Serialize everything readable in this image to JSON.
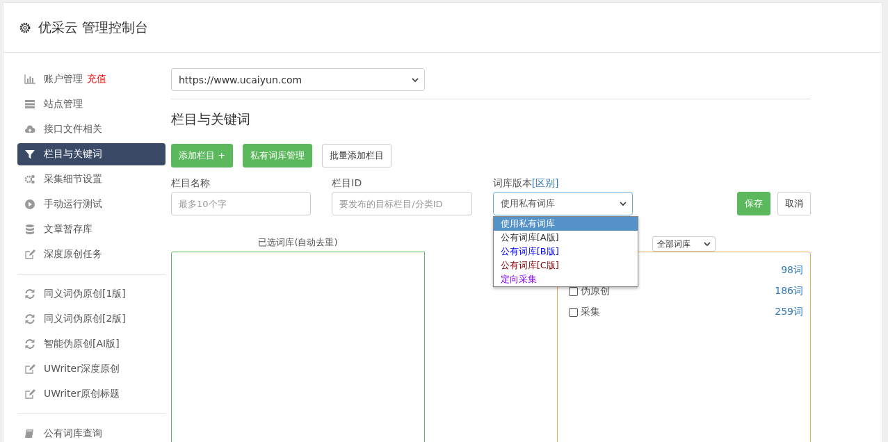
{
  "header": {
    "title": "优采云 管理控制台"
  },
  "sidebar": {
    "groups": [
      [
        {
          "label": "账户管理",
          "badge": "充值",
          "selected": false
        },
        {
          "label": "站点管理",
          "selected": false
        },
        {
          "label": "接口文件相关",
          "selected": false
        },
        {
          "label": "栏目与关键词",
          "selected": true
        },
        {
          "label": "采集细节设置",
          "selected": false
        },
        {
          "label": "手动运行测试",
          "selected": false
        },
        {
          "label": "文章暂存库",
          "selected": false
        },
        {
          "label": "深度原创任务",
          "selected": false
        }
      ],
      [
        {
          "label": "同义词伪原创[1版]",
          "selected": false
        },
        {
          "label": "同义词伪原创[2版]",
          "selected": false
        },
        {
          "label": "智能伪原创[AI版]",
          "selected": false
        },
        {
          "label": "UWriter深度原创",
          "selected": false
        },
        {
          "label": "UWriter原创标题",
          "selected": false
        }
      ],
      [
        {
          "label": "公有词库查询",
          "selected": false
        }
      ]
    ]
  },
  "site_select": {
    "value": "https://www.ucaiyun.com"
  },
  "section_title": "栏目与关键词",
  "actions": [
    {
      "label": "添加栏目 +",
      "kind": "primary"
    },
    {
      "label": "私有词库管理",
      "kind": "primary"
    },
    {
      "label": "批量添加栏目",
      "kind": "default"
    }
  ],
  "form": {
    "name": {
      "label": "栏目名称",
      "placeholder": "最多10个字"
    },
    "id": {
      "label": "栏目ID",
      "placeholder": "要发布的目标栏目/分类ID"
    },
    "version": {
      "label": "词库版本",
      "link": "[区别]",
      "value": "使用私有词库",
      "options": [
        {
          "label": "使用私有词库",
          "selected": true
        },
        {
          "label": "公有词库[A版]",
          "selected": false,
          "color": "#333333"
        },
        {
          "label": "公有词库[B版]",
          "selected": false,
          "color": "#0000ff"
        },
        {
          "label": "公有词库[C版]",
          "selected": false,
          "color": "#8b0000"
        },
        {
          "label": "定向采集",
          "selected": false,
          "color": "#8800ff"
        }
      ]
    },
    "save": "保存",
    "cancel": "取消"
  },
  "selected_label": "已选词库(自动去重)",
  "library_filter": "全部词库",
  "libraries": [
    {
      "count": "98词"
    },
    {
      "label": "伪原创",
      "count": "186词",
      "checked": false
    },
    {
      "label": "采集",
      "count": "259词",
      "checked": false
    }
  ]
}
